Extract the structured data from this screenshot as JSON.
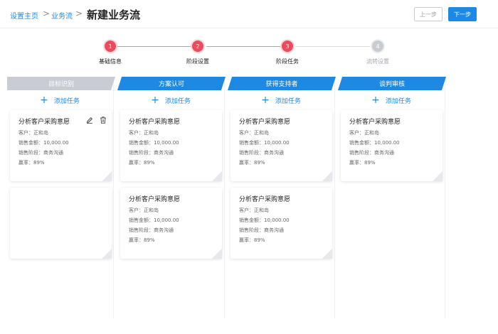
{
  "breadcrumb": {
    "home": "设置主页",
    "sep": ">",
    "flow": "业务流",
    "current": "新建业务流"
  },
  "toolbar": {
    "prev_label": "上一步",
    "next_label": "下一步"
  },
  "steps": [
    {
      "num": "1",
      "label": "基础信息"
    },
    {
      "num": "2",
      "label": "阶段设置"
    },
    {
      "num": "3",
      "label": "阶段任务"
    },
    {
      "num": "4",
      "label": "流转设置"
    }
  ],
  "columns": [
    {
      "title": "目标识别",
      "add_label": "添加任务"
    },
    {
      "title": "方案认可",
      "add_label": "添加任务"
    },
    {
      "title": "获得支持者",
      "add_label": "添加任务"
    },
    {
      "title": "谈判审核",
      "add_label": "添加任务"
    }
  ],
  "card": {
    "title": "分析客户采购意愿",
    "customer": "客户：正和岛",
    "amount": "销售金额：10,000.00",
    "stage": "销售阶段：商务沟通",
    "rate": "赢率：89%"
  },
  "colors": {
    "accent": "#1e88e5",
    "step_active": "#ea4c5e",
    "step_inactive": "#c8cbd0"
  }
}
